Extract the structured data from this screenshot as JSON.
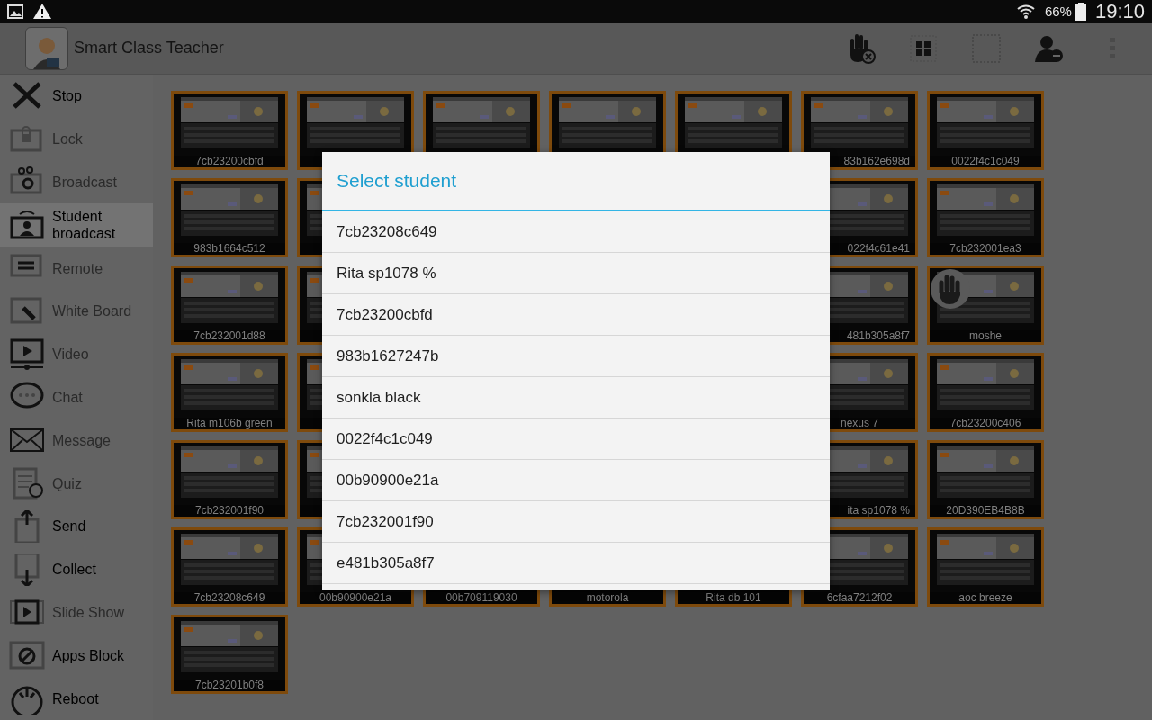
{
  "status_bar": {
    "battery": "66%",
    "time": "19:10"
  },
  "action_bar": {
    "title": "Smart Class Teacher"
  },
  "sidebar": {
    "items": [
      {
        "label": "Stop",
        "enabled": true,
        "selected": false
      },
      {
        "label": "Lock",
        "enabled": false,
        "selected": false
      },
      {
        "label": "Broadcast",
        "enabled": false,
        "selected": false
      },
      {
        "label": "Student broadcast",
        "enabled": true,
        "selected": true
      },
      {
        "label": "Remote",
        "enabled": false,
        "selected": false
      },
      {
        "label": "White Board",
        "enabled": false,
        "selected": false
      },
      {
        "label": "Video",
        "enabled": false,
        "selected": false
      },
      {
        "label": "Chat",
        "enabled": false,
        "selected": false
      },
      {
        "label": "Message",
        "enabled": false,
        "selected": false
      },
      {
        "label": "Quiz",
        "enabled": false,
        "selected": false
      },
      {
        "label": "Send",
        "enabled": true,
        "selected": false
      },
      {
        "label": "Collect",
        "enabled": true,
        "selected": false
      },
      {
        "label": "Slide Show",
        "enabled": false,
        "selected": false
      },
      {
        "label": "Apps Block",
        "enabled": true,
        "selected": false
      },
      {
        "label": "Reboot",
        "enabled": true,
        "selected": false
      }
    ]
  },
  "tile_rows": [
    {
      "left": [
        {
          "label": "7cb23200cbfd",
          "hand_raised": false
        },
        {
          "hand_raised": false
        },
        {
          "hand_raised": false
        },
        {
          "hand_raised": false
        },
        {
          "hand_raised": false
        },
        {
          "label": "83b162e698d",
          "label_cut": true,
          "hand_raised": false
        },
        {
          "label": "0022f4c1c049",
          "label_cut": false,
          "hand_raised": false
        }
      ]
    },
    {
      "left": [
        {
          "label": "983b1664c512",
          "hand_raised": false
        },
        {
          "hand_raised": false
        }
      ],
      "right": [
        {
          "label": "022f4c61e41",
          "label_cut": true,
          "hand_raised": false
        },
        {
          "label": "7cb232001ea3",
          "label_cut": false,
          "hand_raised": false
        }
      ]
    },
    {
      "left": [
        {
          "label": "7cb232001d88",
          "hand_raised": false
        },
        {
          "hand_raised": false
        }
      ],
      "right": [
        {
          "label": "481b305a8f7",
          "label_cut": true,
          "hand_raised": false
        },
        {
          "label": "moshe",
          "label_cut": false,
          "hand_raised": true
        }
      ]
    },
    {
      "left": [
        {
          "label": "Rita m106b green",
          "hand_raised": false
        },
        {
          "hand_raised": false
        }
      ],
      "right": [
        {
          "label": "nexus 7",
          "label_cut": false,
          "hand_raised": false
        },
        {
          "label": "7cb23200c406",
          "label_cut": false,
          "hand_raised": false
        }
      ]
    },
    {
      "left": [
        {
          "label": "7cb232001f90",
          "hand_raised": false
        },
        {
          "hand_raised": false
        }
      ],
      "right": [
        {
          "label": "ita sp1078 %",
          "label_cut": true,
          "hand_raised": false
        },
        {
          "label": "20D390EB4B8B",
          "label_cut": false,
          "hand_raised": false
        }
      ]
    },
    {
      "left": [
        {
          "label": "7cb23208c649",
          "hand_raised": false
        },
        {
          "label": "00b90900e21a",
          "hand_raised": false
        },
        {
          "label": "00b709119030"
        },
        {
          "label": "motorola"
        },
        {
          "label": "Rita db 101"
        },
        {
          "label": "6cfaa7212f02",
          "hand_raised": false
        },
        {
          "label": "aoc breeze",
          "hand_raised": false
        }
      ]
    },
    {
      "left": [
        {
          "label": "7cb23201b0f8",
          "hand_raised": false
        }
      ]
    }
  ],
  "dialog": {
    "title": "Select student",
    "items": [
      "7cb23208c649",
      "Rita sp1078 %",
      "7cb23200cbfd",
      "983b1627247b",
      "sonkla black",
      "0022f4c1c049",
      "00b90900e21a",
      "7cb232001f90",
      "e481b305a8f7"
    ]
  }
}
